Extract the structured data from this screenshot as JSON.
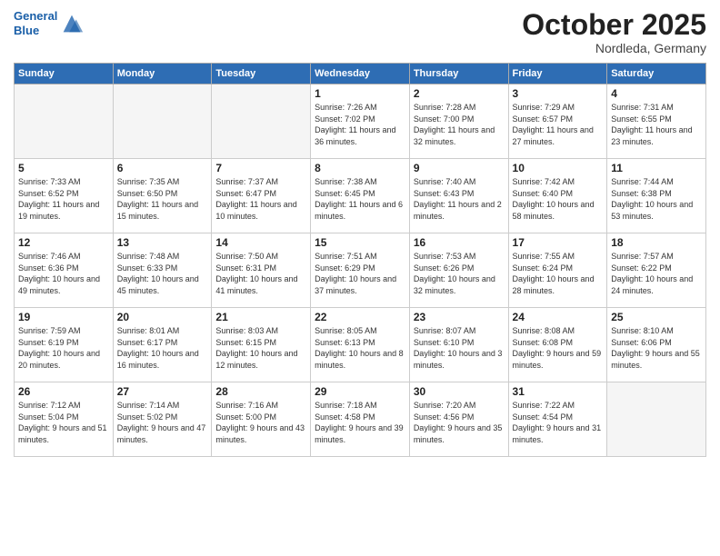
{
  "header": {
    "logo_line1": "General",
    "logo_line2": "Blue",
    "month_title": "October 2025",
    "location": "Nordleda, Germany"
  },
  "days_of_week": [
    "Sunday",
    "Monday",
    "Tuesday",
    "Wednesday",
    "Thursday",
    "Friday",
    "Saturday"
  ],
  "weeks": [
    [
      {
        "day": "",
        "empty": true
      },
      {
        "day": "",
        "empty": true
      },
      {
        "day": "",
        "empty": true
      },
      {
        "day": "1",
        "sunrise": "7:26 AM",
        "sunset": "7:02 PM",
        "daylight": "11 hours and 36 minutes."
      },
      {
        "day": "2",
        "sunrise": "7:28 AM",
        "sunset": "7:00 PM",
        "daylight": "11 hours and 32 minutes."
      },
      {
        "day": "3",
        "sunrise": "7:29 AM",
        "sunset": "6:57 PM",
        "daylight": "11 hours and 27 minutes."
      },
      {
        "day": "4",
        "sunrise": "7:31 AM",
        "sunset": "6:55 PM",
        "daylight": "11 hours and 23 minutes."
      }
    ],
    [
      {
        "day": "5",
        "sunrise": "7:33 AM",
        "sunset": "6:52 PM",
        "daylight": "11 hours and 19 minutes."
      },
      {
        "day": "6",
        "sunrise": "7:35 AM",
        "sunset": "6:50 PM",
        "daylight": "11 hours and 15 minutes."
      },
      {
        "day": "7",
        "sunrise": "7:37 AM",
        "sunset": "6:47 PM",
        "daylight": "11 hours and 10 minutes."
      },
      {
        "day": "8",
        "sunrise": "7:38 AM",
        "sunset": "6:45 PM",
        "daylight": "11 hours and 6 minutes."
      },
      {
        "day": "9",
        "sunrise": "7:40 AM",
        "sunset": "6:43 PM",
        "daylight": "11 hours and 2 minutes."
      },
      {
        "day": "10",
        "sunrise": "7:42 AM",
        "sunset": "6:40 PM",
        "daylight": "10 hours and 58 minutes."
      },
      {
        "day": "11",
        "sunrise": "7:44 AM",
        "sunset": "6:38 PM",
        "daylight": "10 hours and 53 minutes."
      }
    ],
    [
      {
        "day": "12",
        "sunrise": "7:46 AM",
        "sunset": "6:36 PM",
        "daylight": "10 hours and 49 minutes."
      },
      {
        "day": "13",
        "sunrise": "7:48 AM",
        "sunset": "6:33 PM",
        "daylight": "10 hours and 45 minutes."
      },
      {
        "day": "14",
        "sunrise": "7:50 AM",
        "sunset": "6:31 PM",
        "daylight": "10 hours and 41 minutes."
      },
      {
        "day": "15",
        "sunrise": "7:51 AM",
        "sunset": "6:29 PM",
        "daylight": "10 hours and 37 minutes."
      },
      {
        "day": "16",
        "sunrise": "7:53 AM",
        "sunset": "6:26 PM",
        "daylight": "10 hours and 32 minutes."
      },
      {
        "day": "17",
        "sunrise": "7:55 AM",
        "sunset": "6:24 PM",
        "daylight": "10 hours and 28 minutes."
      },
      {
        "day": "18",
        "sunrise": "7:57 AM",
        "sunset": "6:22 PM",
        "daylight": "10 hours and 24 minutes."
      }
    ],
    [
      {
        "day": "19",
        "sunrise": "7:59 AM",
        "sunset": "6:19 PM",
        "daylight": "10 hours and 20 minutes."
      },
      {
        "day": "20",
        "sunrise": "8:01 AM",
        "sunset": "6:17 PM",
        "daylight": "10 hours and 16 minutes."
      },
      {
        "day": "21",
        "sunrise": "8:03 AM",
        "sunset": "6:15 PM",
        "daylight": "10 hours and 12 minutes."
      },
      {
        "day": "22",
        "sunrise": "8:05 AM",
        "sunset": "6:13 PM",
        "daylight": "10 hours and 8 minutes."
      },
      {
        "day": "23",
        "sunrise": "8:07 AM",
        "sunset": "6:10 PM",
        "daylight": "10 hours and 3 minutes."
      },
      {
        "day": "24",
        "sunrise": "8:08 AM",
        "sunset": "6:08 PM",
        "daylight": "9 hours and 59 minutes."
      },
      {
        "day": "25",
        "sunrise": "8:10 AM",
        "sunset": "6:06 PM",
        "daylight": "9 hours and 55 minutes."
      }
    ],
    [
      {
        "day": "26",
        "sunrise": "7:12 AM",
        "sunset": "5:04 PM",
        "daylight": "9 hours and 51 minutes."
      },
      {
        "day": "27",
        "sunrise": "7:14 AM",
        "sunset": "5:02 PM",
        "daylight": "9 hours and 47 minutes."
      },
      {
        "day": "28",
        "sunrise": "7:16 AM",
        "sunset": "5:00 PM",
        "daylight": "9 hours and 43 minutes."
      },
      {
        "day": "29",
        "sunrise": "7:18 AM",
        "sunset": "4:58 PM",
        "daylight": "9 hours and 39 minutes."
      },
      {
        "day": "30",
        "sunrise": "7:20 AM",
        "sunset": "4:56 PM",
        "daylight": "9 hours and 35 minutes."
      },
      {
        "day": "31",
        "sunrise": "7:22 AM",
        "sunset": "4:54 PM",
        "daylight": "9 hours and 31 minutes."
      },
      {
        "day": "",
        "empty": true
      }
    ]
  ]
}
